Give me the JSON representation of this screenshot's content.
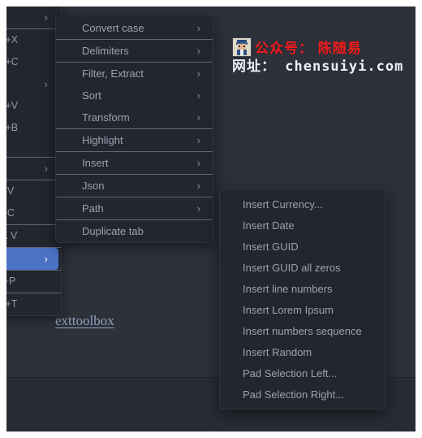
{
  "colors": {
    "app_background": "#282c34",
    "menu_background": "#22262f",
    "menu_text": "#9aa2b1",
    "separator": "#5c677c",
    "selected_highlight": "#4b72c4",
    "watermark_red": "#f21a1a",
    "watermark_white": "#eef1f6",
    "page_link": "#8fa0bd"
  },
  "left_menu": {
    "name": "parent-context-menu",
    "items": [
      {
        "type": "item",
        "shortcut": "",
        "chevron": true
      },
      {
        "type": "separator"
      },
      {
        "type": "item",
        "shortcut": "Ctrl+X",
        "chevron": false
      },
      {
        "type": "item",
        "shortcut": "Ctrl+C",
        "chevron": false
      },
      {
        "type": "item",
        "shortcut": "",
        "chevron": true
      },
      {
        "type": "item",
        "shortcut": "Ctrl+V",
        "chevron": false
      },
      {
        "type": "item",
        "shortcut": "Ctrl+B",
        "chevron": false
      },
      {
        "type": "spacer"
      },
      {
        "type": "separator"
      },
      {
        "type": "item",
        "shortcut": "",
        "chevron": true
      },
      {
        "type": "separator"
      },
      {
        "type": "item",
        "shortcut": "Alt+V",
        "chevron": false
      },
      {
        "type": "item",
        "shortcut": "Alt+C",
        "chevron": false
      },
      {
        "type": "separator"
      },
      {
        "type": "item",
        "shortcut": "rl+K V",
        "chevron": false
      },
      {
        "type": "separator"
      },
      {
        "type": "selected",
        "shortcut": "",
        "chevron": true
      },
      {
        "type": "separator"
      },
      {
        "type": "item",
        "shortcut": "hift+P",
        "chevron": false
      },
      {
        "type": "separator"
      },
      {
        "type": "item",
        "shortcut": "Ctrl+T",
        "chevron": false
      }
    ]
  },
  "mid_menu": {
    "name": "text-tools-context-menu",
    "items": [
      {
        "type": "item",
        "label": "Convert case",
        "chevron": true
      },
      {
        "type": "separator"
      },
      {
        "type": "item",
        "label": "Delimiters",
        "chevron": true
      },
      {
        "type": "separator"
      },
      {
        "type": "item",
        "label": "Filter, Extract",
        "chevron": true
      },
      {
        "type": "item",
        "label": "Sort",
        "chevron": true
      },
      {
        "type": "item",
        "label": "Transform",
        "chevron": true
      },
      {
        "type": "separator"
      },
      {
        "type": "item",
        "label": "Highlight",
        "chevron": true
      },
      {
        "type": "separator"
      },
      {
        "type": "item",
        "label": "Insert",
        "chevron": true
      },
      {
        "type": "separator"
      },
      {
        "type": "item",
        "label": "Json",
        "chevron": true
      },
      {
        "type": "separator"
      },
      {
        "type": "item",
        "label": "Path",
        "chevron": true
      },
      {
        "type": "separator"
      },
      {
        "type": "item",
        "label": "Duplicate tab",
        "chevron": false
      }
    ]
  },
  "insert_submenu": {
    "name": "insert-submenu",
    "items": [
      {
        "label": "Insert Currency..."
      },
      {
        "label": "Insert Date"
      },
      {
        "label": "Insert GUID"
      },
      {
        "label": "Insert GUID all zeros"
      },
      {
        "label": "Insert line numbers"
      },
      {
        "label": "Insert Lorem Ipsum"
      },
      {
        "label": "Insert numbers sequence"
      },
      {
        "label": "Insert Random"
      },
      {
        "label": "Pad Selection Left..."
      },
      {
        "label": "Pad Selection Right..."
      }
    ]
  },
  "page": {
    "link_text": "exttoolbox"
  },
  "watermark": {
    "line1": "公众号： 陈随易",
    "line2_prefix": "网址：",
    "line2_url": "chensuiyi.com"
  }
}
